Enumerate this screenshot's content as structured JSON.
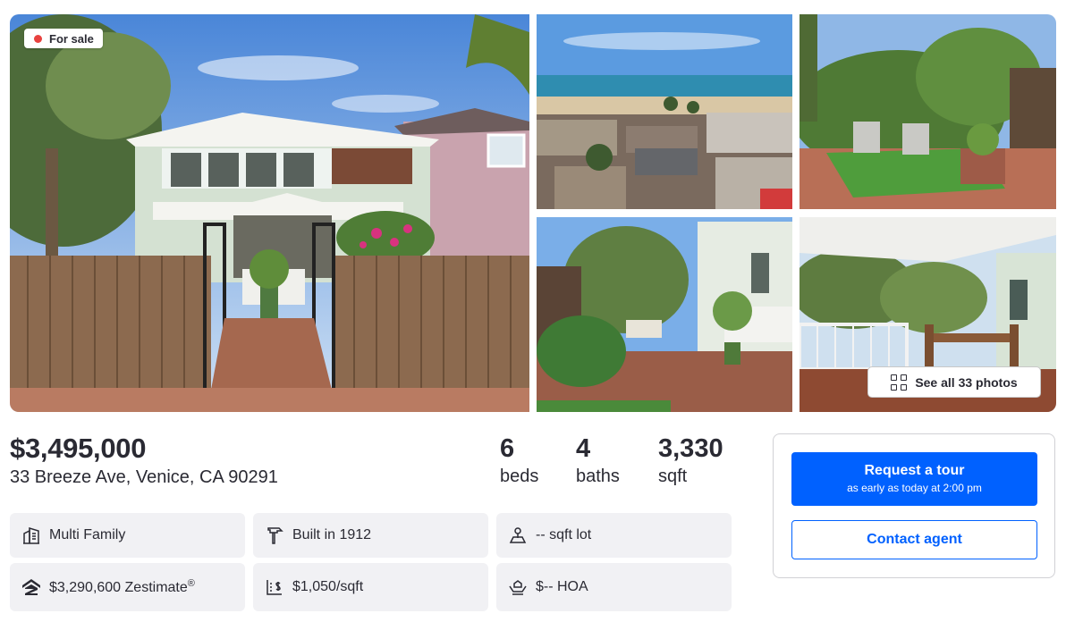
{
  "gallery": {
    "badge_label": "For sale",
    "see_all_label": "See all 33 photos"
  },
  "listing": {
    "price": "$3,495,000",
    "address": "33 Breeze Ave, Venice, CA 90291",
    "stats": {
      "beds_value": "6",
      "beds_label": "beds",
      "baths_value": "4",
      "baths_label": "baths",
      "sqft_value": "3,330",
      "sqft_label": "sqft"
    }
  },
  "facts": {
    "type": {
      "text": "Multi Family",
      "icon": "building-icon"
    },
    "built": {
      "text": "Built in 1912",
      "icon": "hammer-icon"
    },
    "lot": {
      "text": "-- sqft lot",
      "icon": "lot-size-icon"
    },
    "zestimate": {
      "text": "$3,290,600 Zestimate",
      "sup": "®",
      "icon": "zestimate-logo-icon"
    },
    "price_per_sqft": {
      "text": "$1,050/sqft",
      "icon": "price-per-sqft-icon"
    },
    "hoa": {
      "text": "$-- HOA",
      "icon": "hoa-hands-icon"
    }
  },
  "contact": {
    "tour_label": "Request a tour",
    "tour_sublabel": "as early as today at 2:00 pm",
    "contact_label": "Contact agent"
  },
  "colors": {
    "accent": "#0061ff",
    "badge_dot": "#e8423f",
    "fact_bg": "#f1f1f4",
    "text": "#2a2a33"
  }
}
